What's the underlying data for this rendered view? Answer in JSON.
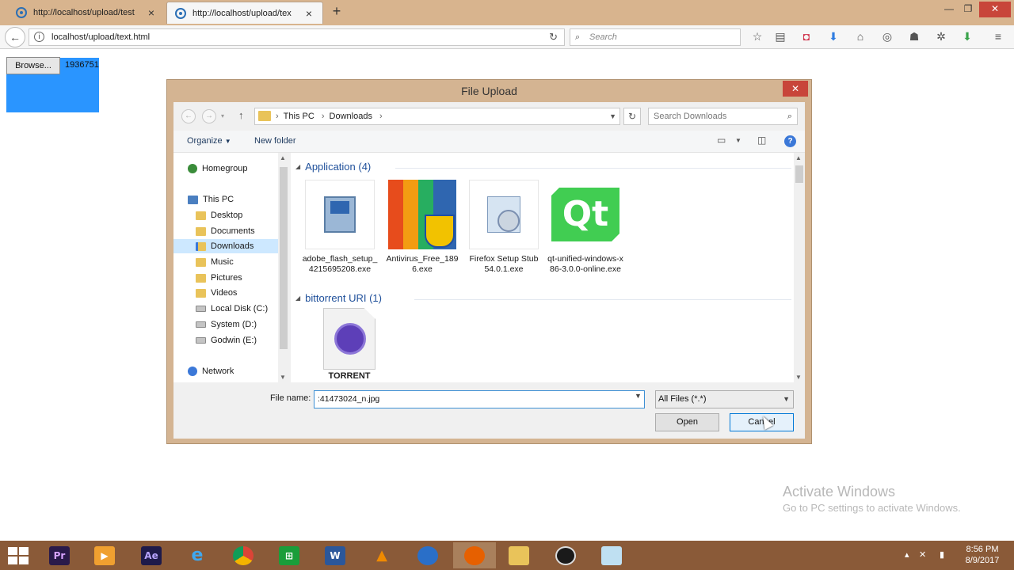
{
  "browser": {
    "tabs": [
      {
        "title": "http://localhost/upload/test",
        "active": false
      },
      {
        "title": "http://localhost/upload/tex",
        "active": true
      }
    ],
    "new_tab": "+",
    "url": "localhost/upload/text.html",
    "search_placeholder": "Search",
    "window_controls": {
      "minimize": "—",
      "restore": "❐",
      "close": "✕"
    },
    "toolbar_icons": [
      "star-icon",
      "reading-list-icon",
      "pocket-icon",
      "download-icon",
      "home-icon",
      "sync-icon",
      "addon-icon",
      "bug-icon",
      "green-download-icon",
      "menu-icon"
    ]
  },
  "page": {
    "browse_button": "Browse...",
    "file_value": "1936751"
  },
  "dialog": {
    "title": "File Upload",
    "close": "✕",
    "breadcrumb": [
      "This PC",
      "Downloads"
    ],
    "search_placeholder": "Search Downloads",
    "commands": {
      "organize": "Organize",
      "new_folder": "New folder"
    },
    "nav": {
      "homegroup": "Homegroup",
      "this_pc": "This PC",
      "desktop": "Desktop",
      "documents": "Documents",
      "downloads": "Downloads",
      "music": "Music",
      "pictures": "Pictures",
      "videos": "Videos",
      "local_disk": "Local Disk (C:)",
      "system": "System (D:)",
      "godwin": "Godwin (E:)",
      "network": "Network"
    },
    "groups": {
      "application": {
        "header": "Application (4)",
        "files": [
          {
            "name": "adobe_flash_setup_4215695208.exe",
            "icon": "installer-icon"
          },
          {
            "name": "Antivirus_Free_1896.exe",
            "icon": "avg-icon"
          },
          {
            "name": "Firefox Setup Stub 54.0.1.exe",
            "icon": "firefox-setup-icon"
          },
          {
            "name": "qt-unified-windows-x86-3.0.0-online.exe",
            "icon": "qt-icon"
          }
        ]
      },
      "bittorrent": {
        "header": "bittorrent URI (1)",
        "files": [
          {
            "name": "TORRENT",
            "icon": "torrent-icon"
          }
        ]
      }
    },
    "file_name_label": "File name:",
    "file_name_value": ":41473024_n.jpg",
    "file_type": "All Files (*.*)",
    "open_button": "Open",
    "cancel_button": "Cancel"
  },
  "watermark": {
    "line1": "Activate Windows",
    "line2": "Go to PC settings to activate Windows."
  },
  "taskbar": {
    "apps": [
      "premiere-icon",
      "vlc-player-icon",
      "after-effects-icon",
      "internet-explorer-icon",
      "chrome-icon",
      "store-icon",
      "word-icon",
      "vlc-icon",
      "unknown-blue-icon",
      "firefox-icon",
      "file-explorer-icon",
      "obs-icon",
      "notepad-icon"
    ],
    "time": "8:56 PM",
    "date": "8/9/2017"
  },
  "colors": {
    "chrome_tan": "#d8b48e",
    "file_input_blue": "#2a95ff",
    "taskbar_brown": "#8a5a38",
    "close_red": "#c8453a",
    "group_header_blue": "#1e4f9a"
  }
}
